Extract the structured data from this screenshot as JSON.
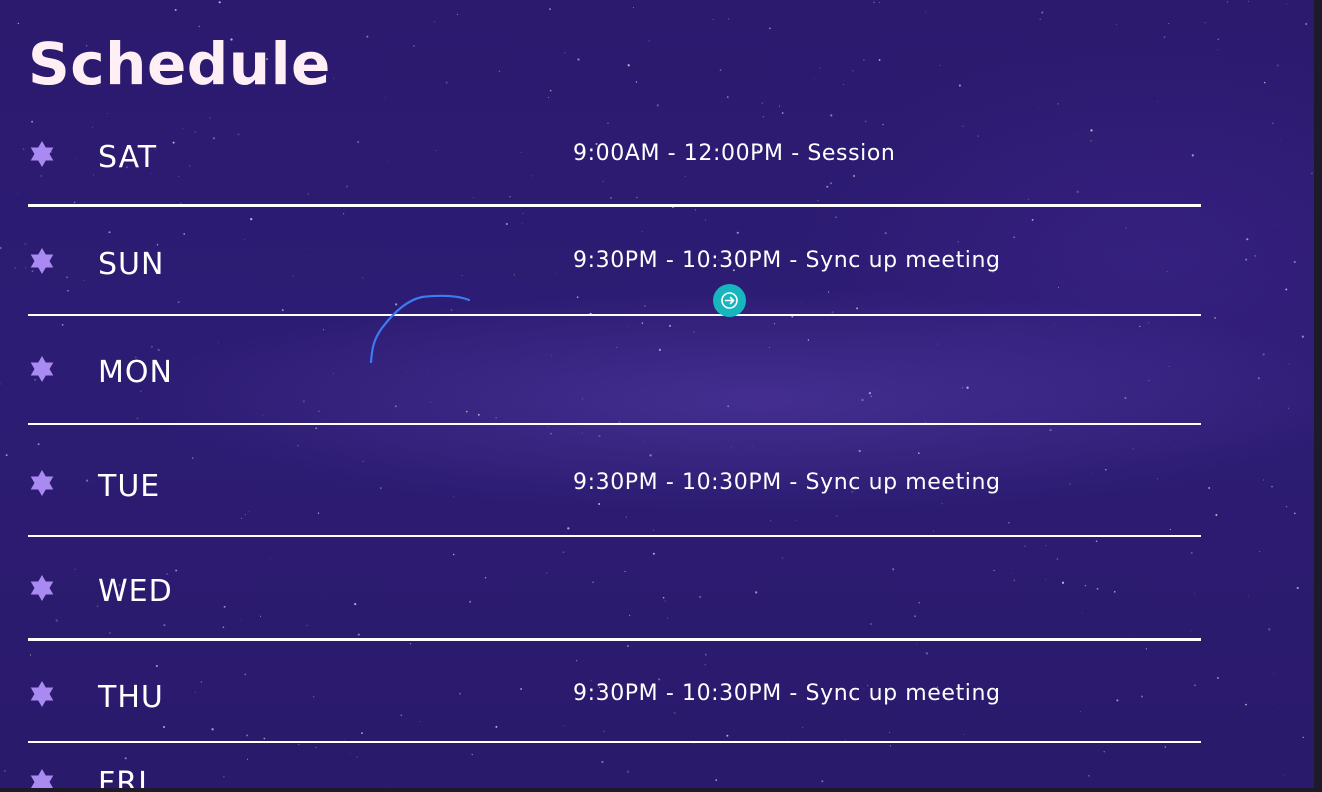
{
  "page": {
    "title": "Schedule",
    "background_color": "#2b1a6e",
    "accent_color": "#a98af0"
  },
  "schedule": {
    "rows": [
      {
        "day": "SAT",
        "event": "9:00AM - 12:00PM - Session"
      },
      {
        "day": "SUN",
        "event": "9:30PM - 10:30PM - Sync up meeting"
      },
      {
        "day": "MON",
        "event": ""
      },
      {
        "day": "TUE",
        "event": "9:30PM - 10:30PM - Sync up meeting"
      },
      {
        "day": "WED",
        "event": ""
      },
      {
        "day": "THU",
        "event": "9:30PM - 10:30PM - Sync up meeting"
      },
      {
        "day": "FRI",
        "event": ""
      }
    ],
    "row_icon": "six-point-star-icon"
  },
  "cursor_widget": {
    "icon": "arrow-right-icon",
    "color": "#17b6bf"
  },
  "annotation": {
    "icon": "pen-stroke",
    "color": "#3b7cf0"
  }
}
